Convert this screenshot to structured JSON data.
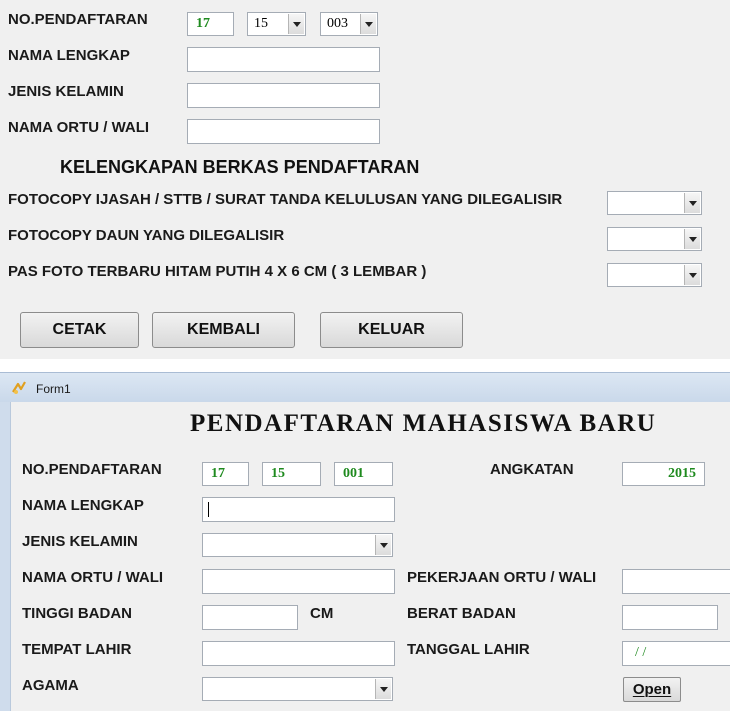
{
  "form_top": {
    "no_pendaftaran_label": "NO.PENDAFTARAN",
    "no_field_1": "17",
    "no_combo_2": "15",
    "no_combo_3": "003",
    "nama_lengkap_label": "NAMA LENGKAP",
    "jenis_kelamin_label": "JENIS KELAMIN",
    "nama_ortu_label": "NAMA ORTU / WALI",
    "section_heading": "KELENGKAPAN BERKAS PENDAFTARAN",
    "doc_1_label": "FOTOCOPY IJASAH / STTB / SURAT TANDA KELULUSAN YANG DILEGALISIR",
    "doc_2_label": "FOTOCOPY DAUN YANG DILEGALISIR",
    "doc_3_label": "PAS FOTO TERBARU HITAM PUTIH 4 X 6 CM ( 3 LEMBAR )",
    "cetak_label": "CETAK",
    "kembali_label": "KEMBALI",
    "keluar_label": "KELUAR"
  },
  "window": {
    "title": "Form1",
    "icon": "form-app-icon"
  },
  "form_bottom": {
    "main_title": "PENDAFTARAN MAHASISWA BARU",
    "no_pendaftaran_label": "NO.PENDAFTARAN",
    "no_field_1": "17",
    "no_field_2": "15",
    "no_field_3": "001",
    "angkatan_label": "ANGKATAN",
    "angkatan_value": "2015",
    "nama_lengkap_label": "NAMA LENGKAP",
    "jenis_kelamin_label": "JENIS KELAMIN",
    "nama_ortu_label": "NAMA ORTU / WALI",
    "pekerjaan_label": "PEKERJAAN ORTU / WALI",
    "tinggi_label": "TINGGI BADAN",
    "cm_label": "CM",
    "berat_label": "BERAT BADAN",
    "tempat_lahir_label": "TEMPAT LAHIR",
    "tanggal_lahir_label": "TANGGAL LAHIR",
    "tanggal_lahir_value": "/ /",
    "agama_label": "AGAMA",
    "open_label": "Open"
  },
  "colors": {
    "value_green": "#1e8a1e",
    "window_titlebar": "#dce7f3"
  }
}
